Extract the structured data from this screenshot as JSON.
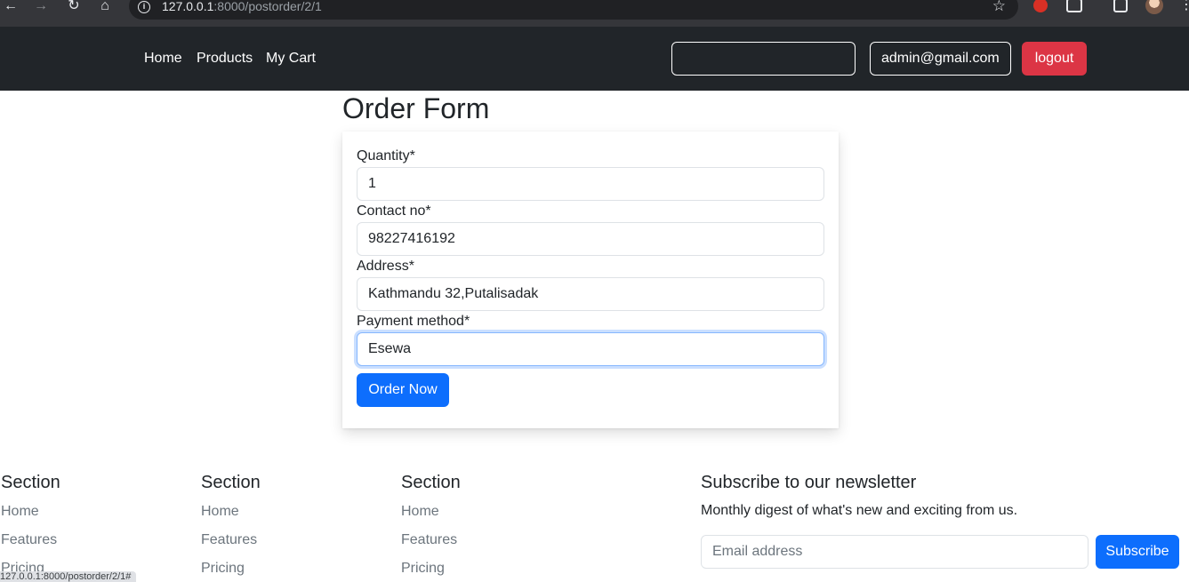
{
  "browser": {
    "url_host": "127.0.0.1",
    "url_rest": ":8000/postorder/2/1",
    "back_icon": "arrow-left",
    "forward_icon": "arrow-right",
    "reload_icon": "reload",
    "home_icon": "home",
    "info_icon": "info-circle",
    "bookmark_icon": "star",
    "status_url": "127.0.0.1:8000/postorder/2/1#"
  },
  "navbar": {
    "links": [
      "Home",
      "Products",
      "My Cart"
    ],
    "search_value": "",
    "user_label": "admin@gmail.com",
    "logout_label": "logout"
  },
  "order_form": {
    "title": "Order Form",
    "fields": [
      {
        "label": "Quantity*",
        "value": "1"
      },
      {
        "label": "Contact no*",
        "value": "98227416192"
      },
      {
        "label": "Address*",
        "value": "Kathmandu 32,Putalisadak"
      },
      {
        "label": "Payment method*",
        "value": "Esewa"
      }
    ],
    "submit_label": "Order Now"
  },
  "footer": {
    "sections": [
      {
        "heading": "Section",
        "links": [
          "Home",
          "Features",
          "Pricing"
        ]
      },
      {
        "heading": "Section",
        "links": [
          "Home",
          "Features",
          "Pricing"
        ]
      },
      {
        "heading": "Section",
        "links": [
          "Home",
          "Features",
          "Pricing"
        ]
      }
    ],
    "newsletter": {
      "title": "Subscribe to our newsletter",
      "description": "Monthly digest of what's new and exciting from us.",
      "email_placeholder": "Email address",
      "subscribe_label": "Subscribe"
    }
  },
  "colors": {
    "navbar_bg": "#212529",
    "primary": "#0d6efd",
    "danger": "#dc3545",
    "muted_text": "#6c757d"
  }
}
